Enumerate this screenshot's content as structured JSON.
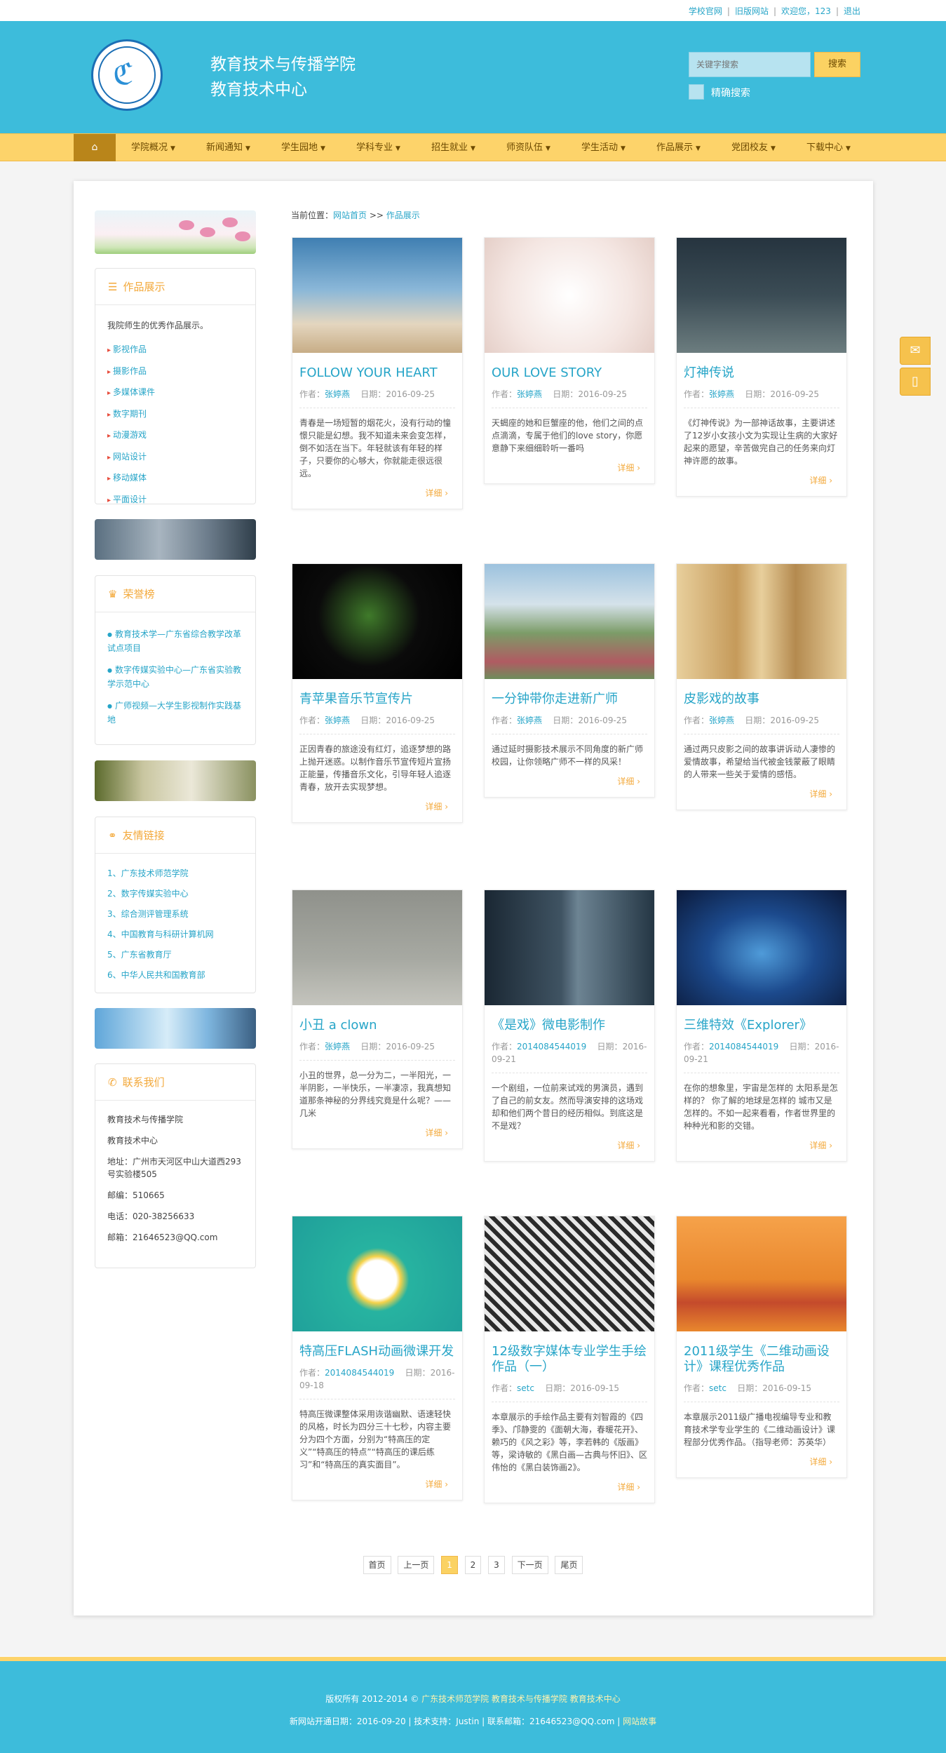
{
  "topbar": {
    "links": [
      "学校官网",
      "旧版网站",
      "欢迎您，123",
      "退出"
    ],
    "separator": "|"
  },
  "header": {
    "title1": "教育技术与传播学院",
    "title2": "教育技术中心",
    "search_placeholder": "关键字搜索",
    "search_button": "搜索",
    "exact_search_label": "精确搜索"
  },
  "nav": {
    "home_icon": "home-icon",
    "items": [
      "学院概况",
      "新闻通知",
      "学生园地",
      "学科专业",
      "招生就业",
      "师资队伍",
      "学生活动",
      "作品展示",
      "党团校友",
      "下载中心"
    ]
  },
  "sidebar": {
    "works": {
      "title": "作品展示",
      "desc": "我院师生的优秀作品展示。",
      "items": [
        "影视作品",
        "摄影作品",
        "多媒体课件",
        "数字期刊",
        "动漫游戏",
        "网站设计",
        "移动媒体",
        "平面设计"
      ]
    },
    "honors": {
      "title": "荣誉榜",
      "items": [
        "教育技术学—广东省综合教学改革试点项目",
        "数字传媒实验中心—广东省实验教学示范中心",
        "广师视频—大学生影视制作实践基地"
      ]
    },
    "links": {
      "title": "友情链接",
      "items": [
        "1、广东技术师范学院",
        "2、数字传媒实验中心",
        "3、综合测评管理系统",
        "4、中国教育与科研计算机网",
        "5、广东省教育厅",
        "6、中华人民共和国教育部"
      ]
    },
    "contact": {
      "title": "联系我们",
      "items": [
        "教育技术与传播学院",
        "教育技术中心",
        "地址：广州市天河区中山大道西293号实验楼505",
        "邮编：510665",
        "电话：020-38256633",
        "邮箱：21646523@QQ.com"
      ]
    }
  },
  "breadcrumb": {
    "prefix": "当前位置：",
    "home": "网站首页",
    "sep": " >> ",
    "current": "作品展示"
  },
  "labels": {
    "author": "作者：",
    "date": "日期：",
    "more": "详细"
  },
  "cards": [
    {
      "title": "FOLLOW YOUR HEART",
      "author": "张婷燕",
      "date": "2016-09-25",
      "excerpt": "青春是一场短暂的烟花火，没有行动的憧憬只能是幻想。我不知道未来会变怎样，倒不如活在当下。年轻就该有年轻的样子，只要你的心够大，你就能走很远很远。"
    },
    {
      "title": "OUR LOVE STORY",
      "author": "张婷燕",
      "date": "2016-09-25",
      "excerpt": "天蝎座的她和巨蟹座的他，他们之间的点点滴滴，专属于他们的love story，你愿意静下来细细聆听一番吗"
    },
    {
      "title": "灯神传说",
      "author": "张婷燕",
      "date": "2016-09-25",
      "excerpt": "《灯神传说》为一部神话故事，主要讲述了12岁小女孩小文为实现让生病的大家好起来的愿望，辛苦做完自己的任务来向灯神许愿的故事。"
    },
    {
      "title": "青苹果音乐节宣传片",
      "author": "张婷燕",
      "date": "2016-09-25",
      "excerpt": "正因青春的旅途没有红灯，追逐梦想的路上抛开迷惑。以制作音乐节宣传短片宣扬正能量，传播音乐文化，引导年轻人追逐青春，放开去实现梦想。"
    },
    {
      "title": "一分钟带你走进新广师",
      "author": "张婷燕",
      "date": "2016-09-25",
      "excerpt": "通过延时摄影技术展示不同角度的新广师校园，让你领略广师不一样的风采！"
    },
    {
      "title": "皮影戏的故事",
      "author": "张婷燕",
      "date": "2016-09-25",
      "excerpt": "通过两只皮影之间的故事讲诉动人凄惨的爱情故事，希望给当代被金钱蒙蔽了眼睛的人带来一些关于爱情的感悟。"
    },
    {
      "title": "小丑 a clown",
      "author": "张婷燕",
      "date": "2016-09-25",
      "excerpt": "小丑的世界，总一分为二，一半阳光，一半阴影，一半快乐，一半凄凉，我真想知道那条神秘的分界线究竟是什么呢？——几米"
    },
    {
      "title": "《是戏》微电影制作",
      "author": "2014084544019",
      "date": "2016-09-21",
      "excerpt": "一个剧组，一位前来试戏的男演员，遇到了自己的前女友。然而导演安排的这场戏却和他们两个昔日的经历相似。到底这是不是戏？"
    },
    {
      "title": "三维特效《Explorer》",
      "author": "2014084544019",
      "date": "2016-09-21",
      "excerpt": "在你的想象里，宇宙是怎样的 太阳系是怎样的？ 你了解的地球是怎样的 城市又是怎样的。不如一起来看看，作者世界里的种种光和影的交错。"
    },
    {
      "title": "特高压FLASH动画微课开发",
      "author": "2014084544019",
      "date": "2016-09-18",
      "excerpt": "特高压微课整体采用诙谐幽默、语速轻快的风格，时长为四分三十七秒，内容主要分为四个方面，分别为“特高压的定义”“特高压的特点”“特高压的课后练习”和“特高压的真实面目”。"
    },
    {
      "title": "12级数字媒体专业学生手绘作品（一）",
      "author": "setc",
      "date": "2016-09-15",
      "excerpt": "本章展示的手绘作品主要有刘智霞的《四季》、邝静雯的《面朝大海，春暖花开》、赖巧的《风之彩》等，李若韩的《版画》等，梁诗敏的《黑白画—古典与怀旧》、区伟怡的《黑白装饰画2》。"
    },
    {
      "title": "2011级学生《二维动画设计》课程优秀作品",
      "author": "setc",
      "date": "2016-09-15",
      "excerpt": "本章展示2011级广播电视编导专业和教育技术学专业学生的《二维动画设计》课程部分优秀作品。（指导老师：苏英华）"
    }
  ],
  "pager": [
    "首页",
    "上一页",
    "1",
    "2",
    "3",
    "下一页",
    "尾页"
  ],
  "footer": {
    "line1_prefix": "版权所有 2012-2014 ©",
    "line1_links": "广东技术师范学院 教育技术与传播学院 教育技术中心",
    "line2": "新网站开通日期：2016-09-20 | 技术支持：Justin | 联系邮箱：21646523@QQ.com |",
    "line2_link": "网站故事"
  },
  "colors": {
    "primary": "#3dbcdb",
    "accent": "#fdd36a",
    "link": "#27a5c8",
    "more": "#f3a93b"
  }
}
